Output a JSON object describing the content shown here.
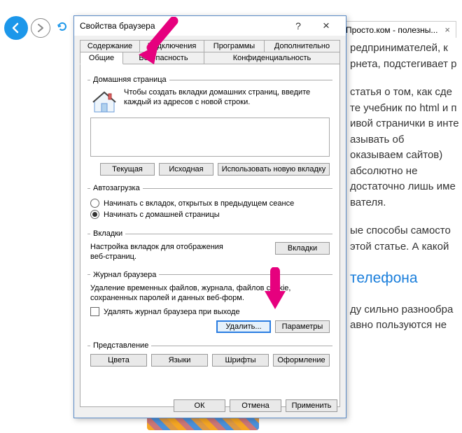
{
  "browser": {
    "tab_label": "Просто.ком - полезны...",
    "back_icon": "←",
    "fwd_icon": "→"
  },
  "dialog": {
    "title": "Свойства браузера",
    "help": "?",
    "close": "×",
    "tabs_row1": [
      "Содержание",
      "Подключения",
      "Программы",
      "Дополнительно"
    ],
    "tabs_row2": [
      "Общие",
      "Безопасность",
      "Конфиденциальность"
    ],
    "active_tab": "Общие",
    "groups": {
      "home": {
        "legend": "Домашняя страница",
        "desc": "Чтобы создать вкладки домашних страниц, введите каждый из адресов с новой строки.",
        "value": "",
        "btn_current": "Текущая",
        "btn_default": "Исходная",
        "btn_newtab": "Использовать новую вкладку"
      },
      "startup": {
        "legend": "Автозагрузка",
        "opt_tabs": "Начинать с вкладок, открытых в предыдущем сеансе",
        "opt_home": "Начинать с домашней страницы",
        "selected": "opt_home"
      },
      "tabs": {
        "legend": "Вкладки",
        "desc": "Настройка вкладок для отображения веб-страниц.",
        "btn": "Вкладки"
      },
      "history": {
        "legend": "Журнал браузера",
        "desc": "Удаление временных файлов, журнала, файлов cookie, сохраненных паролей и данных веб-форм.",
        "check_label": "Удалять журнал браузера при выходе",
        "checked": false,
        "btn_delete": "Удалить...",
        "btn_settings": "Параметры"
      },
      "appearance": {
        "legend": "Представление",
        "btn_colors": "Цвета",
        "btn_langs": "Языки",
        "btn_fonts": "Шрифты",
        "btn_access": "Оформление"
      }
    },
    "footer": {
      "ok": "ОК",
      "cancel": "Отмена",
      "apply": "Применить"
    }
  },
  "page": {
    "p1": "редпринимателей, к рнета, подстегивает р",
    "p2": "статья о том, как сде те учебник по html и п ивой странички в инте азывать об оказываем сайтов) абсолютно не достаточно лишь име вателя.",
    "p3": "ые способы самосто этой статье. А какой",
    "link": "телефона",
    "p4": "ду сильно разнообра авно пользуются не"
  }
}
